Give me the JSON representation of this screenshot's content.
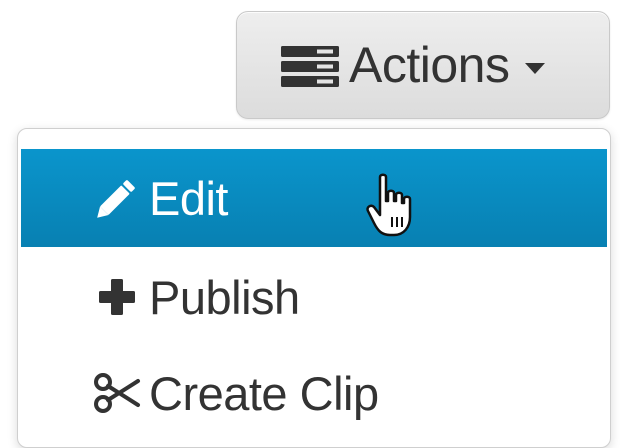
{
  "actions_button": {
    "label": "Actions",
    "icon": "stack-icon",
    "caret_icon": "caret-down-icon"
  },
  "menu": {
    "items": [
      {
        "label": "Edit",
        "icon": "pencil-icon",
        "active": true
      },
      {
        "label": "Publish",
        "icon": "plus-icon",
        "active": false
      },
      {
        "label": "Create Clip",
        "icon": "scissors-icon",
        "active": false
      }
    ]
  },
  "colors": {
    "active_bg": "#0a8ec4",
    "text": "#333333",
    "button_bg": "#e4e4e4"
  }
}
